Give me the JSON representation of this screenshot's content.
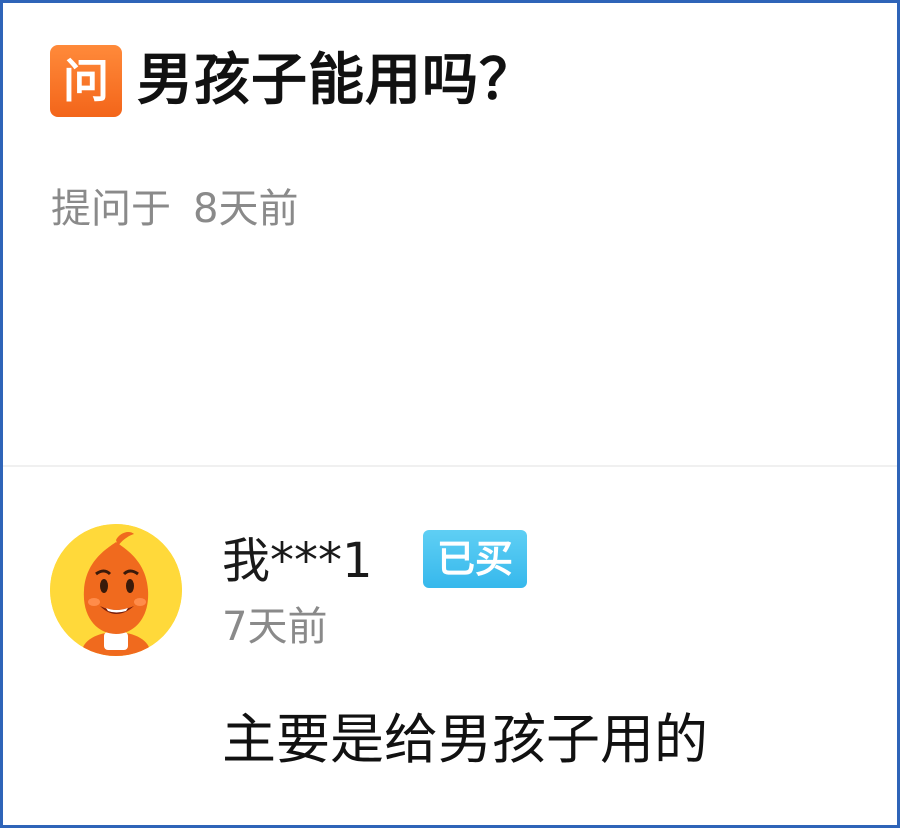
{
  "question": {
    "badge_label": "问",
    "title": "男孩子能用吗？",
    "meta_label": "提问于",
    "meta_time": "8天前"
  },
  "answer": {
    "avatar_icon": "orange-mascot-avatar",
    "username": "我***1",
    "badge_label": "已买",
    "time": "7天前",
    "text": "主要是给男孩子用的"
  },
  "colors": {
    "border": "#2f64b8",
    "question_badge": "#f3651a",
    "bought_badge": "#36b8ec",
    "avatar_bg": "#ffd93a",
    "muted_text": "#8a8a8a"
  }
}
